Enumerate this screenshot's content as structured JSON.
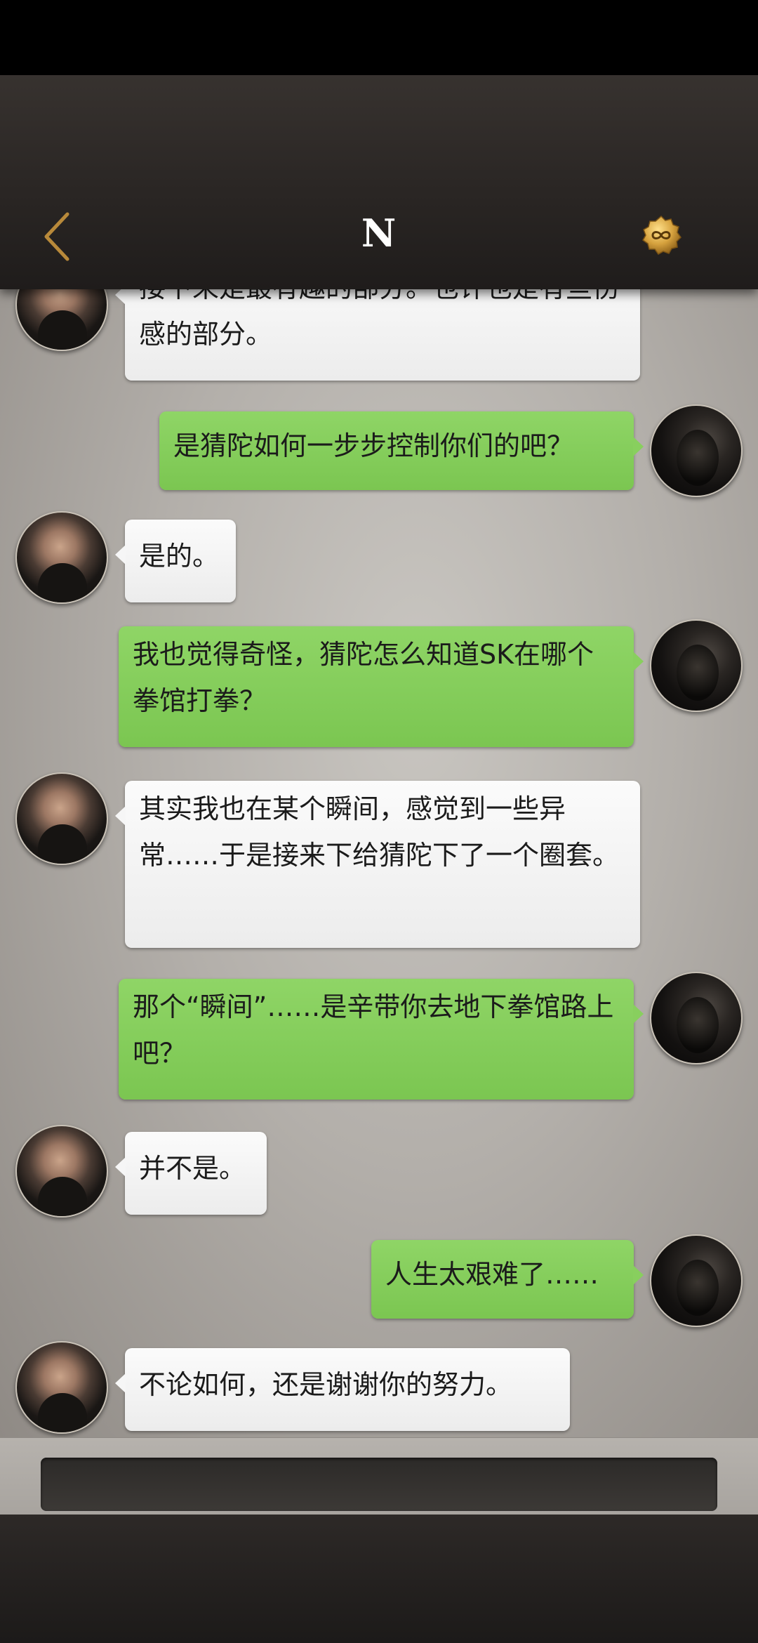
{
  "header": {
    "title": "N"
  },
  "messages": [
    {
      "side": "left",
      "text": "接下来是最有趣的部分。也许也是有些伤感的部分。"
    },
    {
      "side": "right",
      "text": "是猜陀如何一步步控制你们的吧？"
    },
    {
      "side": "left",
      "text": "是的。"
    },
    {
      "side": "right",
      "text": "我也觉得奇怪，猜陀怎么知道SK在哪个拳馆打拳？"
    },
    {
      "side": "left",
      "text": "其实我也在某个瞬间，感觉到一些异常……于是接来下给猜陀下了一个圈套。"
    },
    {
      "side": "right",
      "text": "那个“瞬间”……是辛带你去地下拳馆路上吧？"
    },
    {
      "side": "left",
      "text": "并不是。"
    },
    {
      "side": "right",
      "text": "人生太艰难了……"
    },
    {
      "side": "left",
      "text": "不论如何，还是谢谢你的努力。"
    }
  ],
  "colors": {
    "accent_gold": "#c9963d",
    "bubble_green": "#86cd5c",
    "bubble_white": "#f4f4f4"
  }
}
